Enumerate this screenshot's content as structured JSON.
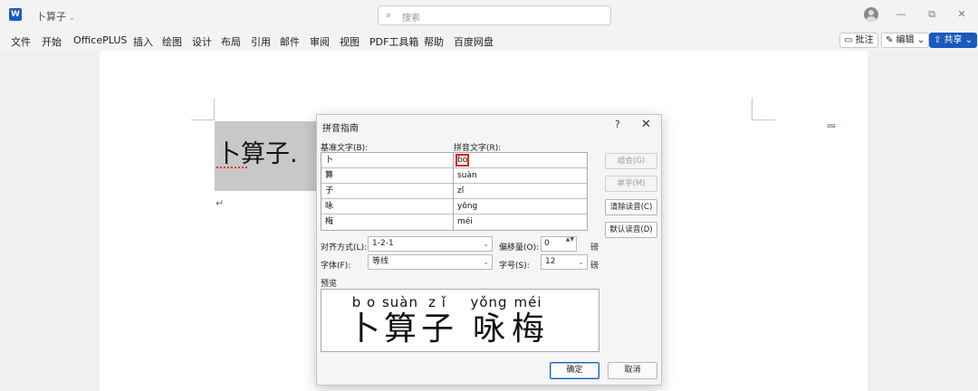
{
  "titlebar": {
    "doc_title": "卜算子",
    "title_chevron": "⌄",
    "logo_letter": "W",
    "search_icon": "⌕",
    "search_placeholder": "搜索",
    "minimize": "—",
    "restore": "⧉",
    "close": "✕"
  },
  "menu": {
    "items": [
      "文件",
      "开始",
      "OfficePLUS",
      "插入",
      "绘图",
      "设计",
      "布局",
      "引用",
      "邮件",
      "审阅",
      "视图",
      "PDF工具箱",
      "帮助",
      "百度网盘"
    ],
    "comment_btn": "▭ 批注",
    "edit_btn": "✎ 编辑 ⌄",
    "share_btn": "⇪ 共享 ⌄"
  },
  "document": {
    "text": "卜算子.",
    "return_mark": "↵",
    "comment_icon": "⮹"
  },
  "dialog": {
    "title": "拼音指南",
    "help": "?",
    "close": "✕",
    "base_label": "基准文字(B):",
    "ruby_label": "拼音文字(R):",
    "base_text": [
      "卜",
      "算",
      "子",
      "咏",
      "梅"
    ],
    "ruby_text": [
      "bo",
      "suàn",
      "zǐ",
      "yǒng",
      "méi"
    ],
    "side_buttons": [
      "组合(G)",
      "单字(M)",
      "清除读音(C)",
      "默认读音(D)"
    ],
    "align_label": "对齐方式(L):",
    "align_value": "1-2-1",
    "offset_label": "偏移量(O):",
    "offset_value": "0",
    "offset_unit": "磅",
    "font_label": "字体(F):",
    "font_value": "等线",
    "size_label": "字号(S):",
    "size_value": "12",
    "size_unit": "磅",
    "preview_label": "预览",
    "preview": [
      {
        "py": "b o",
        "hz": "卜"
      },
      {
        "py": "suàn",
        "hz": "算"
      },
      {
        "py": "z ǐ",
        "hz": "子"
      },
      {
        "py": "yǒng",
        "hz": "咏"
      },
      {
        "py": "méi",
        "hz": "梅"
      }
    ],
    "ok": "确定",
    "cancel": "取消",
    "spin_arrows": "▲▼",
    "combo_arrow": "⌄"
  },
  "colors": {
    "accent": "#185abd",
    "highlight": "#e02020",
    "selection": "#c8c8c8"
  }
}
